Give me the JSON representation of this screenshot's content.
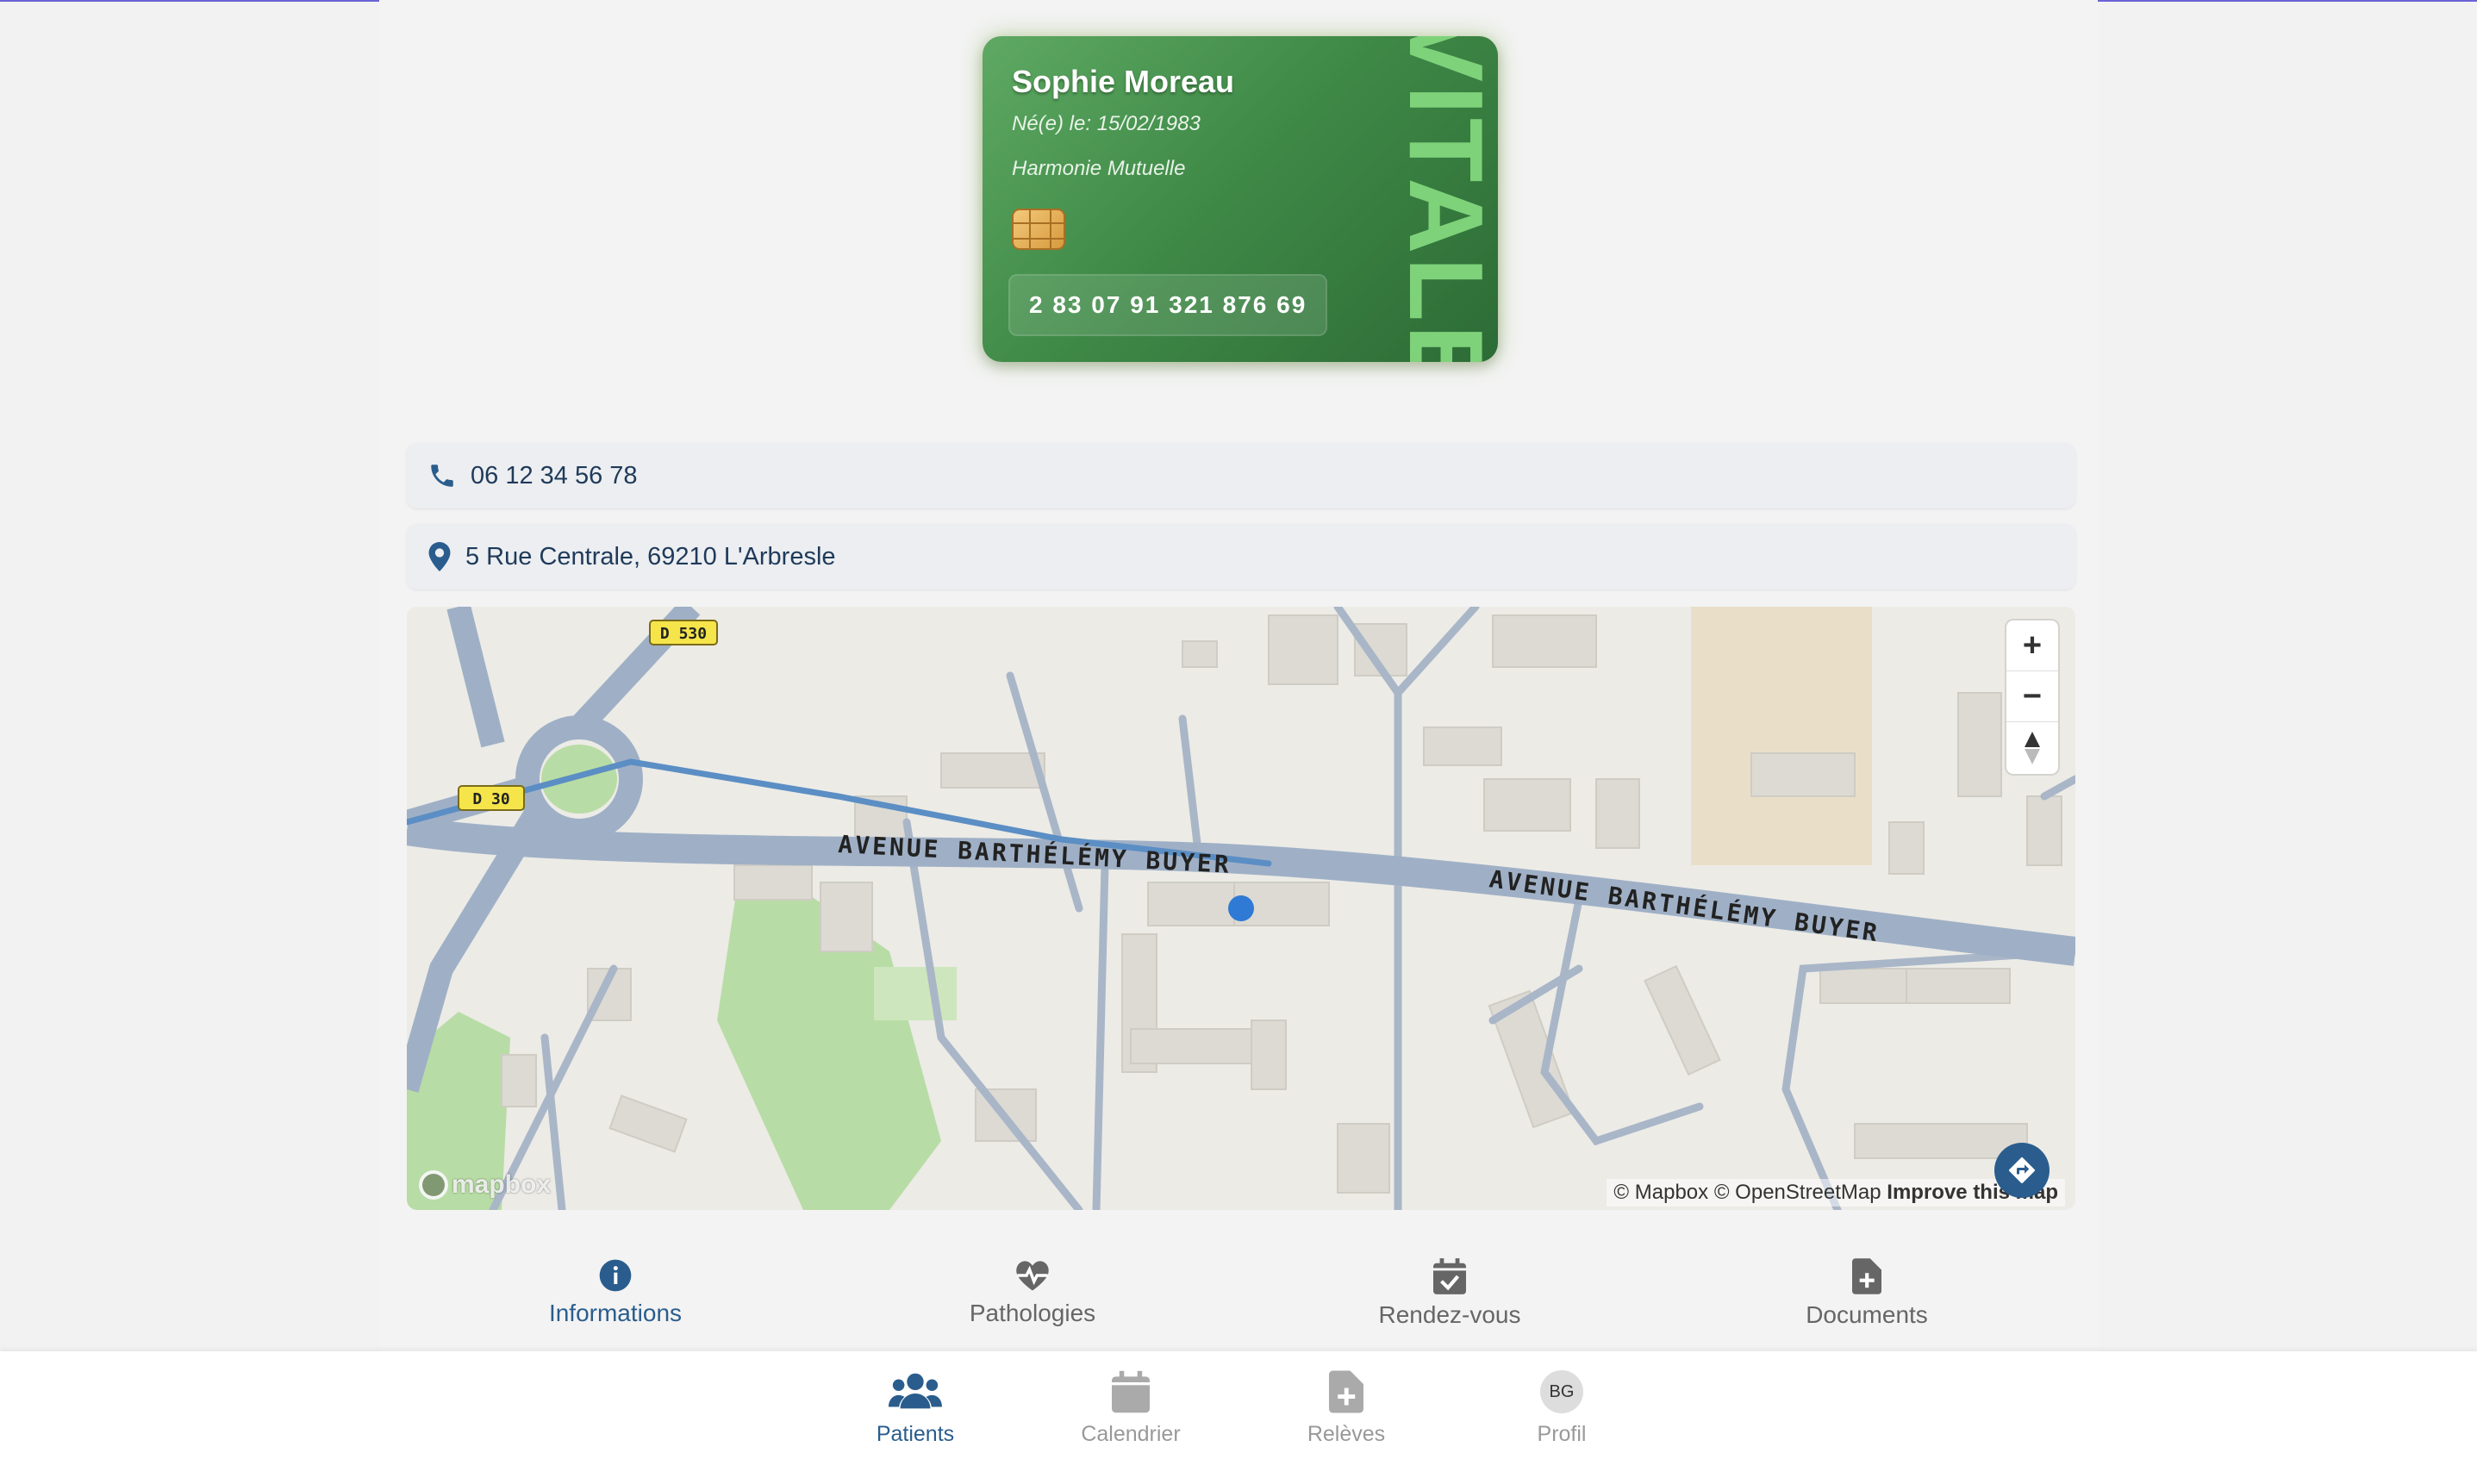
{
  "card": {
    "name": "Sophie Moreau",
    "dob": "Né(e) le: 15/02/1983",
    "mutuelle": "Harmonie Mutuelle",
    "number": "2 83 07 91 321 876 69",
    "brand": "VITALE"
  },
  "contact": {
    "phone": "06 12 34 56 78",
    "address": "5 Rue Centrale, 69210 L'Arbresle"
  },
  "map": {
    "street_label": "AVENUE BARTHÉLÉMY BUYER",
    "road_badge_1": "D 530",
    "road_badge_2": "D 30",
    "attribution_mapbox": "© Mapbox",
    "attribution_osm": "© OpenStreetMap",
    "improve": "Improve this map",
    "logo": "mapbox",
    "zoom_in": "+",
    "zoom_out": "−"
  },
  "tabs": [
    {
      "label": "Informations",
      "icon": "info-icon",
      "active": true
    },
    {
      "label": "Pathologies",
      "icon": "heartbeat-icon"
    },
    {
      "label": "Rendez-vous",
      "icon": "calendar-check-icon"
    },
    {
      "label": "Documents",
      "icon": "file-plus-icon"
    }
  ],
  "bottom_nav": [
    {
      "label": "Patients",
      "icon": "users-icon",
      "active": true
    },
    {
      "label": "Calendrier",
      "icon": "calendar-icon"
    },
    {
      "label": "Relèves",
      "icon": "file-medical-icon"
    },
    {
      "label": "Profil",
      "icon": "avatar",
      "initials": "BG"
    }
  ],
  "colors": {
    "accent": "#2a5d8d",
    "card_green": "#3f8a47",
    "route_blue": "#5b8ec4",
    "top_line": "#6b63d6"
  }
}
